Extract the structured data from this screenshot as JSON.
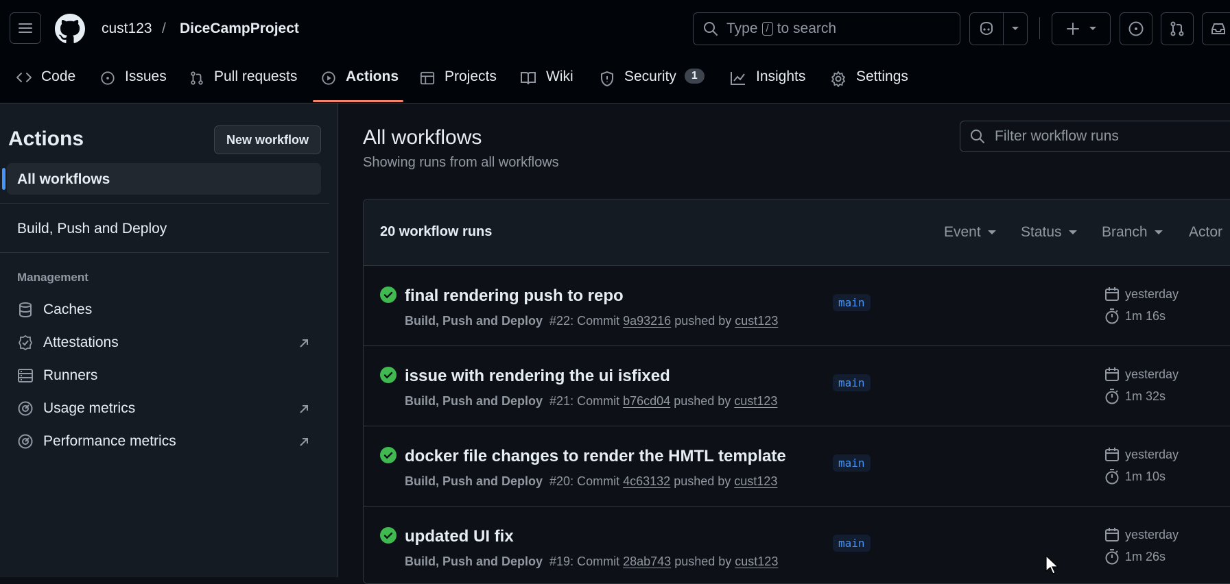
{
  "header": {
    "owner": "cust123",
    "separator": "/",
    "repo": "DiceCampProject",
    "search_prefix": "Type",
    "search_key": "/",
    "search_suffix": "to search"
  },
  "tabs": [
    {
      "label": "Code",
      "icon": "code-icon"
    },
    {
      "label": "Issues",
      "icon": "issue-icon"
    },
    {
      "label": "Pull requests",
      "icon": "pull-request-icon"
    },
    {
      "label": "Actions",
      "icon": "play-icon",
      "active": true
    },
    {
      "label": "Projects",
      "icon": "table-icon"
    },
    {
      "label": "Wiki",
      "icon": "book-icon"
    },
    {
      "label": "Security",
      "icon": "shield-icon",
      "count": "1"
    },
    {
      "label": "Insights",
      "icon": "graph-icon"
    },
    {
      "label": "Settings",
      "icon": "gear-icon"
    }
  ],
  "sidebar": {
    "title": "Actions",
    "new_workflow": "New workflow",
    "all_workflows": "All workflows",
    "workflow": "Build, Push and Deploy",
    "management_heading": "Management",
    "management": [
      {
        "label": "Caches",
        "icon": "database-icon"
      },
      {
        "label": "Attestations",
        "icon": "verified-icon"
      },
      {
        "label": "Runners",
        "icon": "server-icon"
      },
      {
        "label": "Usage metrics",
        "icon": "meter-icon"
      },
      {
        "label": "Performance metrics",
        "icon": "meter-icon"
      }
    ]
  },
  "main": {
    "title": "All workflows",
    "subtitle": "Showing runs from all workflows",
    "filter_placeholder": "Filter workflow runs",
    "runs_count": "20 workflow runs",
    "filters": [
      "Event",
      "Status",
      "Branch",
      "Actor"
    ],
    "runs": [
      {
        "title": "final rendering push to repo",
        "workflow": "Build, Push and Deploy",
        "number": "#22",
        "commit_label": ": Commit",
        "commit": "9a93216",
        "pushed_by": "pushed by",
        "user": "cust123",
        "branch": "main",
        "when": "yesterday",
        "duration": "1m 16s"
      },
      {
        "title": "issue with rendering the ui isfixed",
        "workflow": "Build, Push and Deploy",
        "number": "#21",
        "commit_label": ": Commit",
        "commit": "b76cd04",
        "pushed_by": "pushed by",
        "user": "cust123",
        "branch": "main",
        "when": "yesterday",
        "duration": "1m 32s"
      },
      {
        "title": "docker file changes to render the HMTL template",
        "workflow": "Build, Push and Deploy",
        "number": "#20",
        "commit_label": ": Commit",
        "commit": "4c63132",
        "pushed_by": "pushed by",
        "user": "cust123",
        "branch": "main",
        "when": "yesterday",
        "duration": "1m 10s"
      },
      {
        "title": "updated UI fix",
        "workflow": "Build, Push and Deploy",
        "number": "#19",
        "commit_label": ": Commit",
        "commit": "28ab743",
        "pushed_by": "pushed by",
        "user": "cust123",
        "branch": "main",
        "when": "yesterday",
        "duration": "1m 26s"
      }
    ]
  },
  "colors": {
    "success": "#3fb950",
    "accent_underline": "#f78166",
    "branch_text": "#4493f8"
  }
}
